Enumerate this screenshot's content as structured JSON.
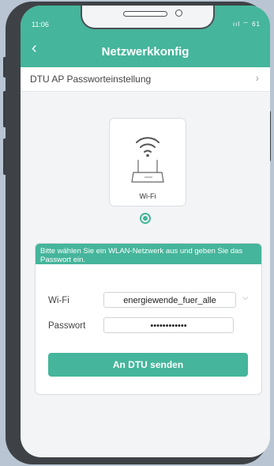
{
  "status": {
    "time": "11:06",
    "icons": "ııl ⌔ 61"
  },
  "nav": {
    "back_icon": "chevron-left-icon",
    "title": "Netzwerkkonfig"
  },
  "ap_row": {
    "label": "DTU AP Passworteinstellung",
    "chevron_icon": "chevron-right-icon"
  },
  "device": {
    "caption": "Wi-Fi",
    "icon": "router-wifi-icon",
    "selected": true
  },
  "panel": {
    "instruction": "Bitte wählen Sie ein WLAN-Netzwerk aus und geben Sie das Passwort ein.",
    "wifi_label": "Wi-Fi",
    "wifi_value": "energiewende_fuer_alle",
    "password_label": "Passwort",
    "password_value": "••••••••••••",
    "send_label": "An DTU senden"
  },
  "colors": {
    "accent": "#45b59b",
    "background": "#f3f4f6"
  }
}
